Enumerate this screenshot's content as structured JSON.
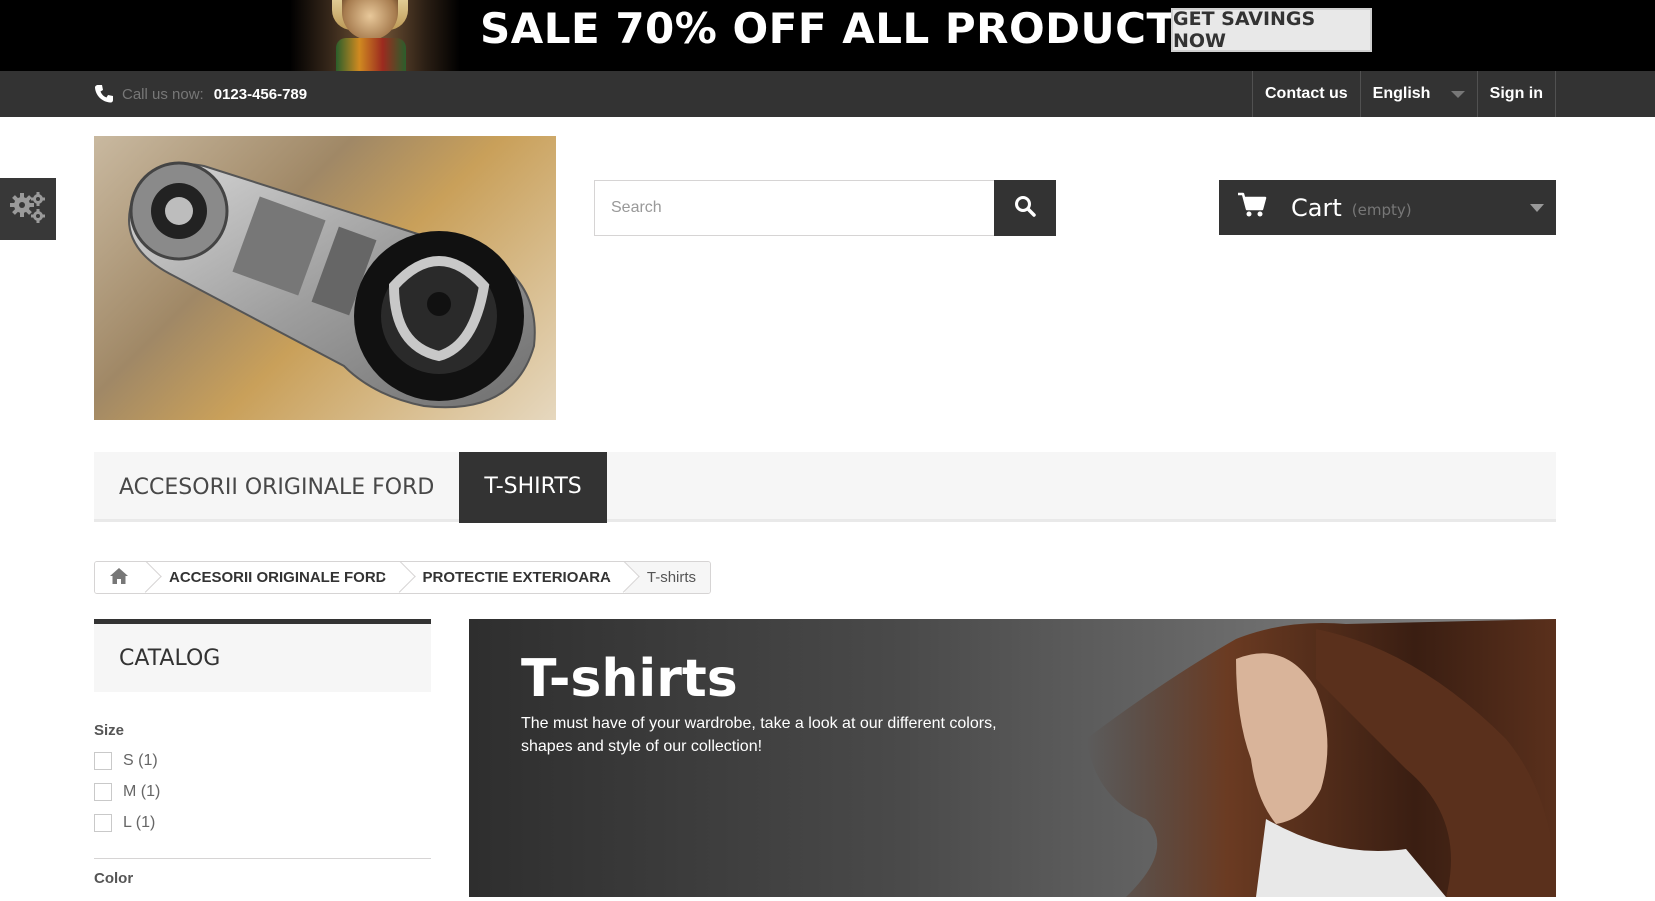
{
  "promo": {
    "text": "SALE 70% OFF ALL PRODUCTS",
    "button": "GET SAVINGS NOW"
  },
  "topbar": {
    "call_label": "Call us now:",
    "phone": "0123-456-789",
    "contact": "Contact us",
    "language": "English",
    "signin": "Sign in"
  },
  "search": {
    "placeholder": "Search"
  },
  "cart": {
    "title": "Cart",
    "status": "(empty)"
  },
  "menu": {
    "items": [
      {
        "label": "ACCESORII ORIGINALE FORD"
      },
      {
        "label": "T-SHIRTS"
      }
    ]
  },
  "breadcrumb": {
    "items": [
      "ACCESORII ORIGINALE FORD",
      "PROTECTIE EXTERIOARA",
      "T-shirts"
    ]
  },
  "sidebar": {
    "title": "CATALOG",
    "size_title": "Size",
    "sizes": [
      "S (1)",
      "M (1)",
      "L (1)"
    ],
    "color_title": "Color"
  },
  "category": {
    "title": "T-shirts",
    "description": "The must have of your wardrobe, take a look at our different colors, shapes and style of our collection!"
  },
  "colors": {
    "dark": "#333333",
    "menu_bg": "#f6f6f6",
    "border": "#d6d4d4"
  },
  "icons": [
    "phone-icon",
    "gear-icon",
    "search-icon",
    "cart-icon",
    "home-icon"
  ]
}
